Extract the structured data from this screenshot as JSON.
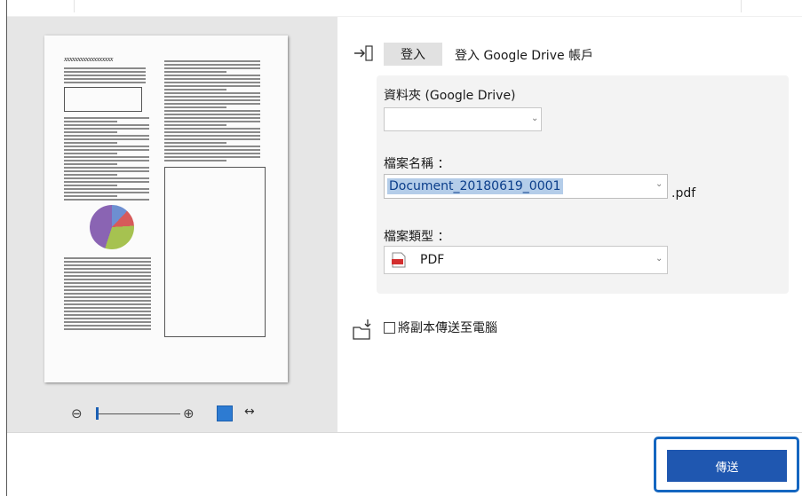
{
  "login": {
    "button_label": "登入",
    "account_text": "登入 Google Drive 帳戶"
  },
  "folder": {
    "label": "資料夾 (Google Drive)",
    "value": ""
  },
  "filename": {
    "label": "檔案名稱 ：",
    "value": "Document_20180619_0001",
    "extension": ".pdf"
  },
  "filetype": {
    "label": "檔案類型 ：",
    "value": "PDF"
  },
  "copy_to_pc": {
    "label": "將副本傳送至電腦",
    "checked": false
  },
  "send_button": {
    "label": "傳送"
  },
  "preview": {
    "page_heading": "xxxxxxxxxxxxxxxxxx",
    "zoom_level": 0.0
  },
  "colors": {
    "accent": "#1f57b0",
    "focus_frame": "#1466c0",
    "selection": "#b4cde9"
  }
}
